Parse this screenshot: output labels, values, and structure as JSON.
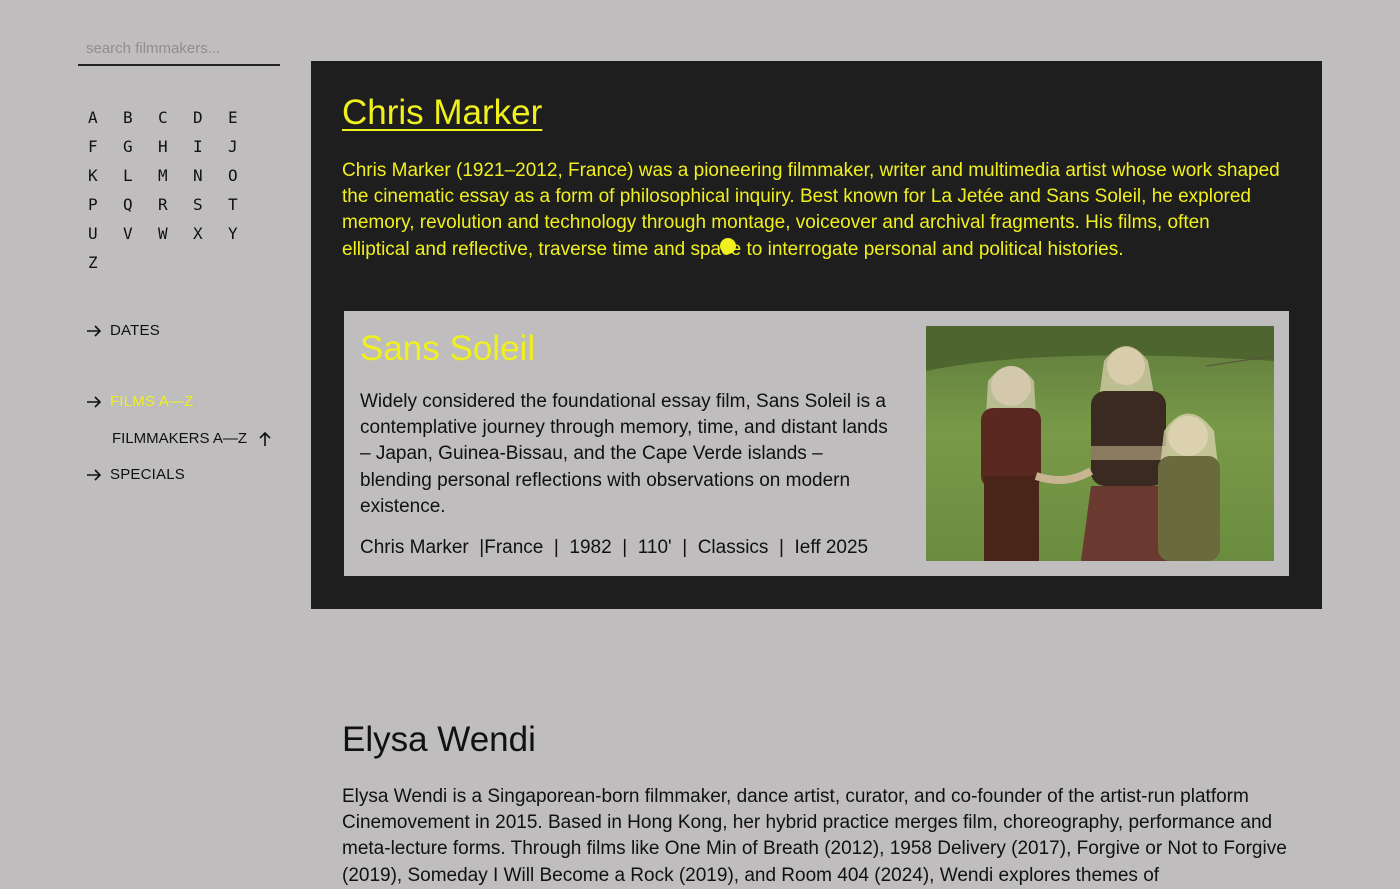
{
  "search": {
    "placeholder": "search filmmakers..."
  },
  "letters": [
    "A",
    "B",
    "C",
    "D",
    "E",
    "F",
    "G",
    "H",
    "I",
    "J",
    "K",
    "L",
    "M",
    "N",
    "O",
    "P",
    "Q",
    "R",
    "S",
    "T",
    "U",
    "V",
    "W",
    "X",
    "Y",
    "Z"
  ],
  "nav": {
    "dates": "DATES",
    "films_az": "FILMS A—Z",
    "filmmakers_az": "FILMMAKERS A—Z",
    "specials": "SPECIALS"
  },
  "colors": {
    "accent": "#f0f01e",
    "background": "#bfbdbe",
    "panel": "#1e1e1e"
  },
  "featured": {
    "name": "Chris Marker",
    "bio": "Chris Marker (1921–2012, France) was a pioneering filmmaker, writer and multimedia artist whose work shaped the cinematic essay as a form of philosophical inquiry. Best known for La Jetée and Sans Soleil, he explored memory, revolution and technology through montage, voiceover and archival fragments. His films, often elliptical and reflective, traverse time and space to interrogate personal and political histories.",
    "film": {
      "title": "Sans Soleil",
      "description": "Widely considered the foundational essay film, Sans Soleil is a contemplative journey through memory, time, and distant lands – Japan, Guinea-Bissau, and the Cape Verde islands – blending personal reflections with observations on modern existence.",
      "meta": "Chris Marker  |France  |  1982  |  110'  |  Classics  |  Ieff 2025"
    }
  },
  "next": {
    "name": "Elysa Wendi",
    "bio": "Elysa Wendi is a Singaporean-born filmmaker, dance artist, curator, and co-founder of the artist-run platform Cinemovement in 2015. Based in Hong Kong, her hybrid practice merges film, choreography, performance and meta-lecture forms. Through films like One Min of Breath (2012), 1958 Delivery (2017), Forgive or Not to Forgive (2019), Someday I Will Become a Rock (2019), and Room 404 (2024), Wendi explores themes of"
  }
}
